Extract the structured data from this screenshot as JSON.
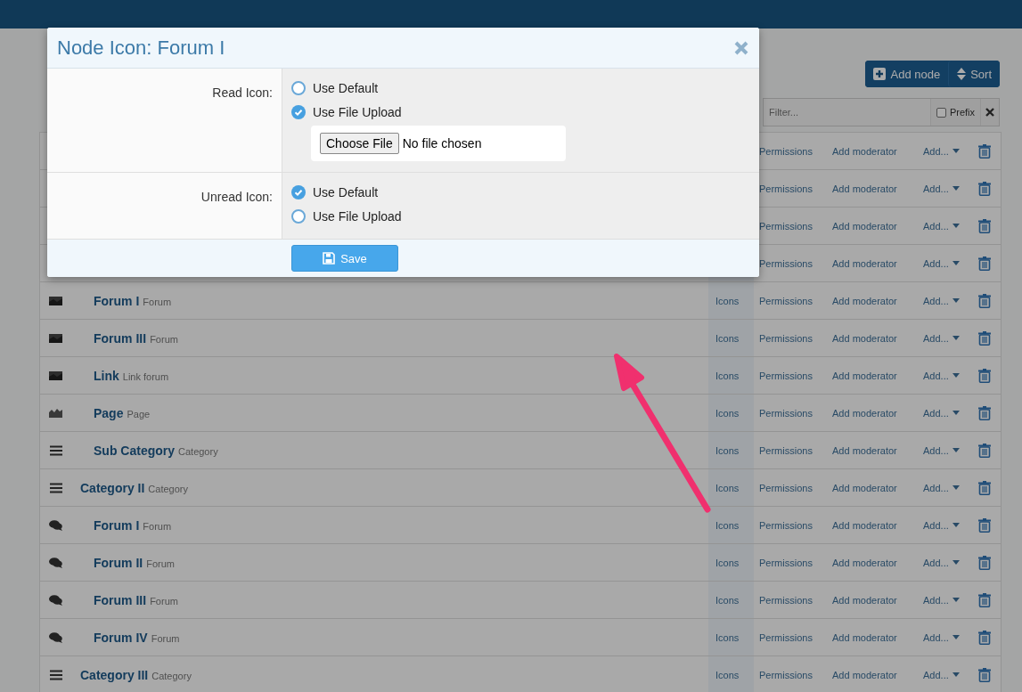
{
  "header_buttons": [
    {
      "kind": "add",
      "label": "Add node"
    },
    {
      "kind": "sort",
      "label": "Sort"
    }
  ],
  "filter": {
    "placeholder": "Filter...",
    "prefix_label": "Prefix",
    "prefix_checked": false
  },
  "nodes": [
    {
      "permissions": "Permissions",
      "add_moderator": "Add moderator",
      "add_menu": "Add..."
    },
    {
      "permissions": "Permissions",
      "add_moderator": "Add moderator",
      "add_menu": "Add..."
    },
    {
      "permissions": "Permissions",
      "add_moderator": "Add moderator",
      "add_menu": "Add..."
    },
    {
      "permissions": "Permissions",
      "add_moderator": "Add moderator",
      "add_menu": "Add...",
      "children": [
        {
          "kind": "image",
          "title": "Forum I",
          "type": "Forum",
          "icons": "Icons",
          "permissions": "Permissions",
          "add_moderator": "Add moderator",
          "add_menu": "Add..."
        },
        {
          "kind": "image",
          "title": "Forum III",
          "type": "Forum",
          "icons": "Icons",
          "permissions": "Permissions",
          "add_moderator": "Add moderator",
          "add_menu": "Add..."
        },
        {
          "kind": "image",
          "title": "Link",
          "type": "Link forum",
          "icons": "Icons",
          "permissions": "Permissions",
          "add_moderator": "Add moderator",
          "add_menu": "Add..."
        },
        {
          "kind": "page",
          "title": "Page",
          "type": "Page",
          "icons": "Icons",
          "permissions": "Permissions",
          "add_moderator": "Add moderator",
          "add_menu": "Add..."
        },
        {
          "kind": "category",
          "title": "Sub Category",
          "type": "Category",
          "icons": "Icons",
          "permissions": "Permissions",
          "add_moderator": "Add moderator",
          "add_menu": "Add..."
        }
      ]
    },
    {
      "kind": "category",
      "title": "Category II",
      "type": "Category",
      "icons": "Icons",
      "permissions": "Permissions",
      "add_moderator": "Add moderator",
      "add_menu": "Add...",
      "children": [
        {
          "kind": "chat",
          "title": "Forum I",
          "type": "Forum",
          "icons": "Icons",
          "permissions": "Permissions",
          "add_moderator": "Add moderator",
          "add_menu": "Add..."
        },
        {
          "kind": "chat",
          "title": "Forum II",
          "type": "Forum",
          "icons": "Icons",
          "permissions": "Permissions",
          "add_moderator": "Add moderator",
          "add_menu": "Add..."
        },
        {
          "kind": "chat",
          "title": "Forum III",
          "type": "Forum",
          "icons": "Icons",
          "permissions": "Permissions",
          "add_moderator": "Add moderator",
          "add_menu": "Add..."
        },
        {
          "kind": "chat",
          "title": "Forum IV",
          "type": "Forum",
          "icons": "Icons",
          "permissions": "Permissions",
          "add_moderator": "Add moderator",
          "add_menu": "Add..."
        }
      ]
    },
    {
      "kind": "category",
      "title": "Category III",
      "type": "Category",
      "icons": "Icons",
      "permissions": "Permissions",
      "add_moderator": "Add moderator",
      "add_menu": "Add..."
    }
  ],
  "dialog": {
    "title": "Node Icon: Forum I",
    "fields": [
      {
        "label": "Read Icon:",
        "options": [
          {
            "label": "Use Default",
            "selected": false
          },
          {
            "label": "Use File Upload",
            "selected": true
          }
        ],
        "file_input": {
          "button": "Choose File",
          "status": "No file chosen"
        }
      },
      {
        "label": "Unread Icon:",
        "options": [
          {
            "label": "Use Default",
            "selected": true
          },
          {
            "label": "Use File Upload",
            "selected": false
          }
        ]
      }
    ],
    "save": "Save"
  }
}
